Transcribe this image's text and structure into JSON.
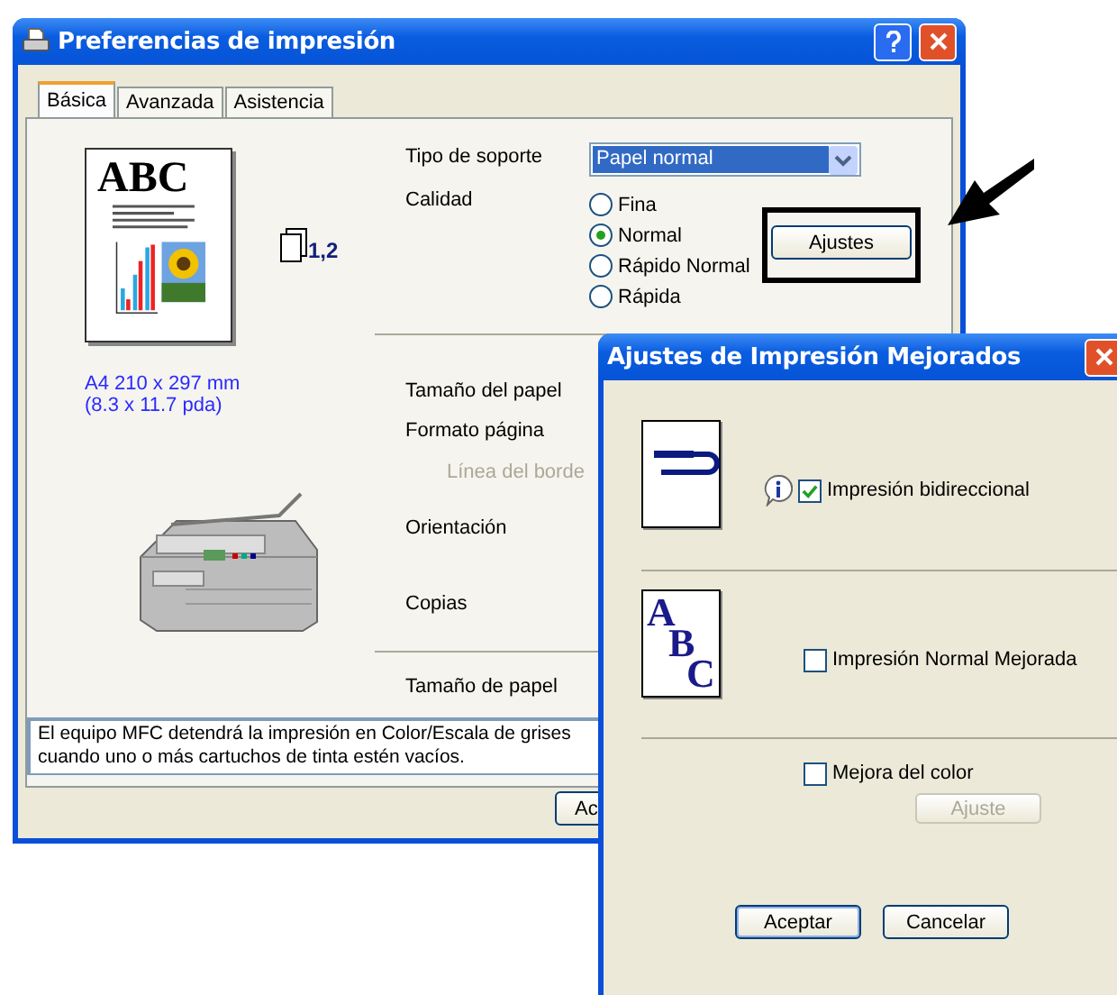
{
  "main_window": {
    "title": "Preferencias de impresión",
    "tabs": [
      {
        "label": "Básica",
        "selected": true
      },
      {
        "label": "Avanzada",
        "selected": false
      },
      {
        "label": "Asistencia",
        "selected": false
      }
    ],
    "preview": {
      "heading": "ABC",
      "copies": "1,2",
      "size_lines": [
        "A4 210 x 297 mm",
        "(8.3 x 11.7 pda)"
      ]
    },
    "media_type": {
      "label": "Tipo de soporte",
      "value": "Papel normal"
    },
    "quality": {
      "label": "Calidad",
      "options": [
        {
          "label": "Fina",
          "selected": false
        },
        {
          "label": "Normal",
          "selected": true
        },
        {
          "label": "Rápido Normal",
          "selected": false
        },
        {
          "label": "Rápida",
          "selected": false
        }
      ]
    },
    "settings_button": "Ajustes",
    "labels": [
      {
        "text": "Tamaño del papel",
        "disabled": false
      },
      {
        "text": "Formato página",
        "disabled": false
      },
      {
        "text": "Línea del borde",
        "disabled": true
      },
      {
        "text": "Orientación",
        "disabled": false
      },
      {
        "text": "Copias",
        "disabled": false
      }
    ],
    "paper_size_label": "Tamaño de papel",
    "note_lines": [
      "El equipo MFC detendrá la impresión en Color/Escala de grises",
      "cuando uno o más cartuchos de tinta estén vacíos."
    ],
    "buttons": [
      "Ac"
    ]
  },
  "dialog": {
    "title": "Ajustes de Impresión Mejorados",
    "sections": [
      {
        "kind": "return",
        "checkbox": {
          "label": "Impresión bidireccional",
          "checked": true,
          "info": true
        }
      },
      {
        "kind": "letters",
        "letters": [
          "A",
          "B",
          "C"
        ],
        "checkbox": {
          "label": "Impresión Normal Mejorada",
          "checked": false,
          "info": false
        }
      },
      {
        "kind": "plain",
        "checkbox": {
          "label": "Mejora del color",
          "checked": false,
          "info": false
        },
        "button": {
          "label": "Ajuste",
          "disabled": true
        }
      }
    ],
    "buttons": [
      "Aceptar",
      "Cancelar"
    ]
  }
}
